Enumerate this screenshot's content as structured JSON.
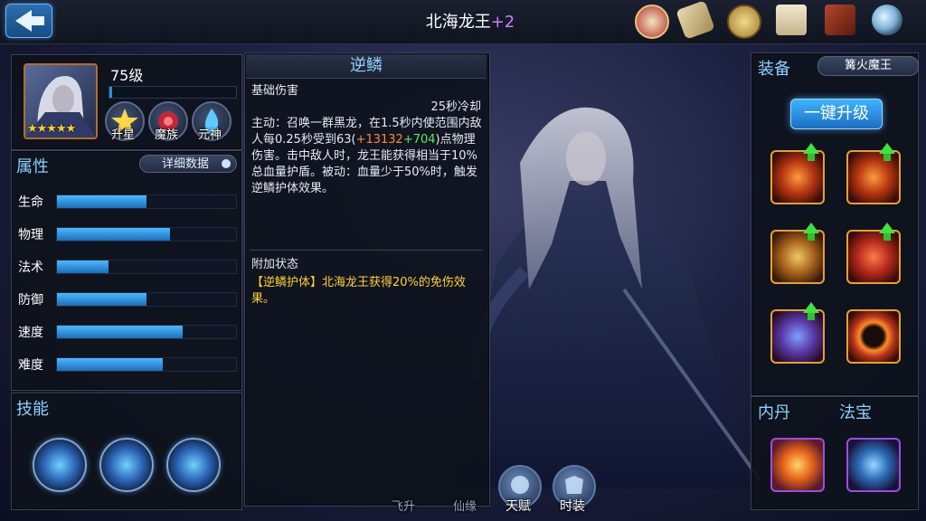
{
  "header": {
    "hero_name": "北海龙王",
    "hero_plus": "+2"
  },
  "top_icons": [
    "battle-seal-icon",
    "scroll-icon",
    "coin-icon",
    "document-icon",
    "book-icon",
    "magnifier-icon"
  ],
  "hero_info": {
    "level": "75级",
    "level_progress": 0.02,
    "stars": "★★★★★",
    "buttons": [
      {
        "label": "升星",
        "icon": "star-up-icon"
      },
      {
        "label": "魔族",
        "icon": "demon-race-icon"
      },
      {
        "label": "元神",
        "icon": "spirit-flame-icon"
      }
    ]
  },
  "attributes": {
    "title": "属性",
    "detail_button": "详细数据",
    "stats": [
      {
        "label": "生命",
        "value": 0.5
      },
      {
        "label": "物理",
        "value": 0.63
      },
      {
        "label": "法术",
        "value": 0.29
      },
      {
        "label": "防御",
        "value": 0.5
      },
      {
        "label": "速度",
        "value": 0.7
      },
      {
        "label": "难度",
        "value": 0.59
      }
    ]
  },
  "skills": {
    "title": "技能"
  },
  "skill_detail": {
    "name": "逆鳞",
    "section1": "基础伤害",
    "cooldown": "25秒冷却",
    "desc_a": "主动：召唤一群黑龙，在1.5秒内使范围内敌人每0.25秒受到63(",
    "desc_bonus1": "+13132",
    "desc_bonus2": "+704",
    "desc_b": ")点物理伤害。击中敌人时，龙王能获得相当于10%总血量护盾。被动：血量少于50%时，触发逆鳞护体效果。",
    "section2": "附加状态",
    "status_tag": "【逆鳞护体】",
    "status_text": "北海龙王获得20%的免伤效果。"
  },
  "equipment": {
    "title": "装备",
    "preset": "篝火魔王",
    "upgrade_all": "一键升级"
  },
  "inner_core": {
    "title": "内丹"
  },
  "treasure": {
    "title": "法宝"
  },
  "bottom_tabs": [
    {
      "label": "飞升",
      "dim": true
    },
    {
      "label": "仙缘",
      "dim": true
    },
    {
      "label": "天赋"
    },
    {
      "label": "时装"
    }
  ],
  "colors": {
    "accent": "#8fd0ff",
    "bonus_orange": "#ff8a3a",
    "bonus_green": "#5fea5f",
    "highlight": "#ffd23a",
    "hero_plus": "#d07cff"
  }
}
